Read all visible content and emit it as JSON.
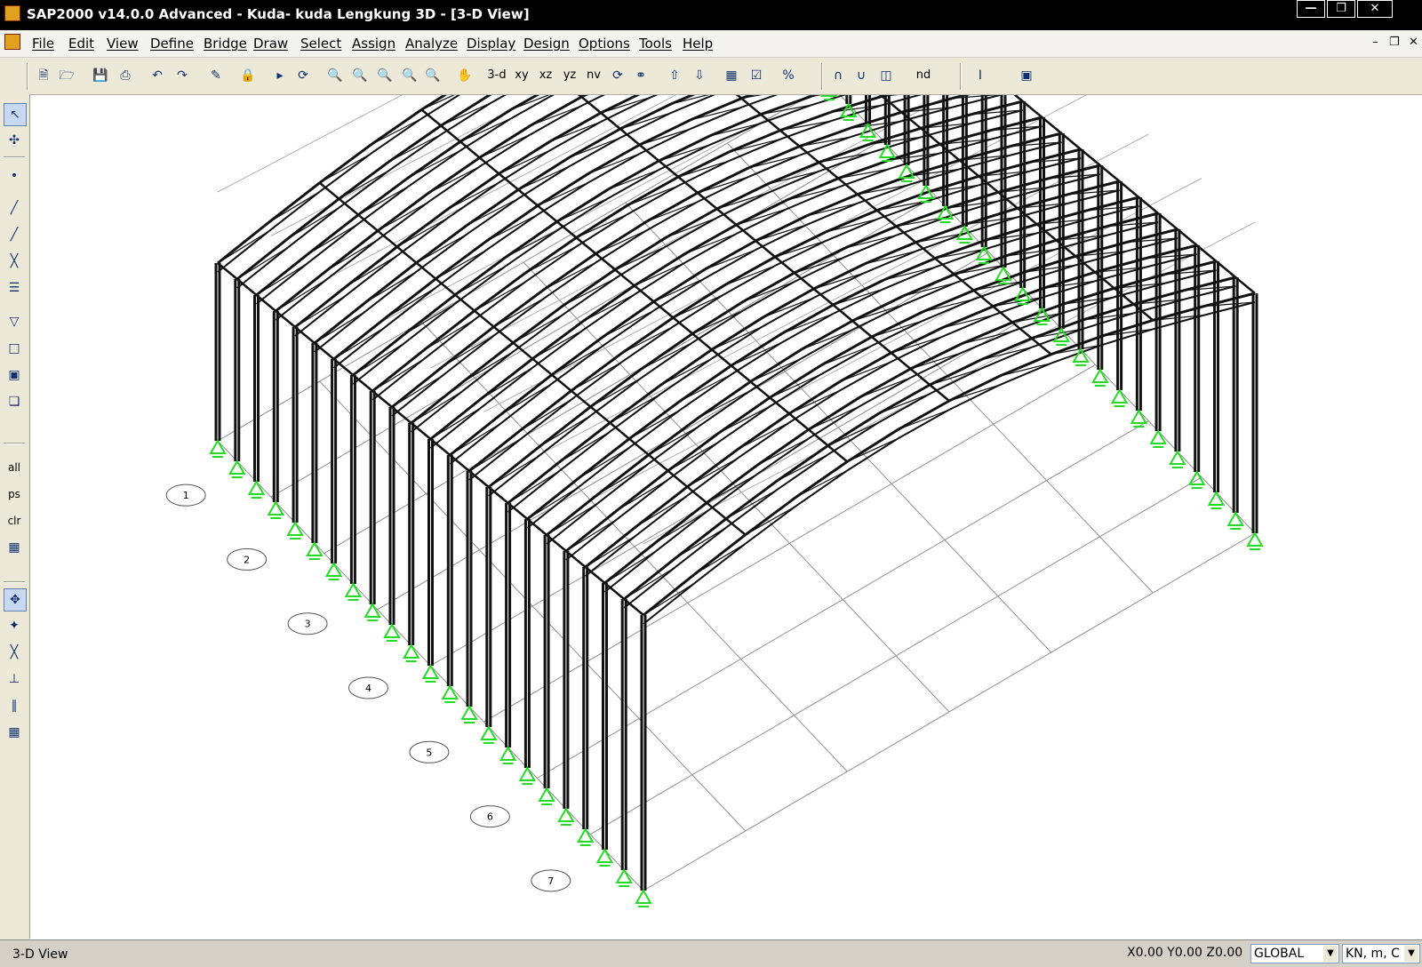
{
  "window": {
    "title": "SAP2000 v14.0.0 Advanced  - Kuda- kuda Lengkung 3D - [3-D View]",
    "controls": [
      "minimize-icon",
      "restore-icon",
      "close-icon"
    ]
  },
  "menu": {
    "items": [
      "File",
      "Edit",
      "View",
      "Define",
      "Bridge",
      "Draw",
      "Select",
      "Assign",
      "Analyze",
      "Display",
      "Design",
      "Options",
      "Tools",
      "Help"
    ]
  },
  "toolbar": {
    "view_labels": {
      "three_d": "3-d",
      "xy": "xy",
      "xz": "xz",
      "yz": "yz",
      "nv": "nv",
      "nd": "nd"
    }
  },
  "left_toolbar": {
    "select_labels": {
      "all": "all",
      "ps": "ps",
      "clr": "clr"
    }
  },
  "viewport": {
    "view": "3-D View",
    "grid_bubbles": [
      "1",
      "2",
      "3",
      "4",
      "5",
      "6",
      "7"
    ],
    "support_color": "#22dd22",
    "member_color": "#111111",
    "grid_color": "#909090"
  },
  "status": {
    "view_name": "3-D View",
    "coordinates": "X0.00  Y0.00  Z0.00",
    "coord_system": "GLOBAL",
    "units": "KN, m, C"
  }
}
